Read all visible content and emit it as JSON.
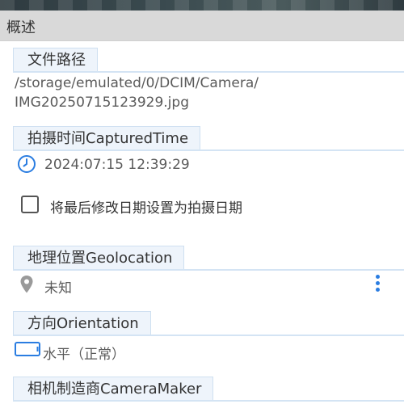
{
  "header": {
    "title": "概述"
  },
  "sections": {
    "file_path": {
      "label": "文件路径",
      "line1": "/storage/emulated/0/DCIM/Camera/",
      "line2": "IMG20250715123929.jpg"
    },
    "captured_time": {
      "label": "拍摄时间CapturedTime",
      "value": "2024:07:15 12:39:29",
      "checkbox_label": "将最后修改日期设置为拍摄日期",
      "checkbox_checked": false
    },
    "geolocation": {
      "label": "地理位置Geolocation",
      "value": "未知"
    },
    "orientation": {
      "label": "方向Orientation",
      "value": "水平（正常）"
    },
    "camera_maker": {
      "label": "相机制造商CameraMaker"
    }
  },
  "icons": {
    "clock": "clock-icon",
    "location": "location-pin-icon",
    "orientation": "screen-landscape-icon",
    "more": "more-vertical-icon"
  },
  "colors": {
    "accent": "#2a7de1",
    "section_bg": "#eef4fb",
    "header_bg": "#d9d9d9"
  }
}
